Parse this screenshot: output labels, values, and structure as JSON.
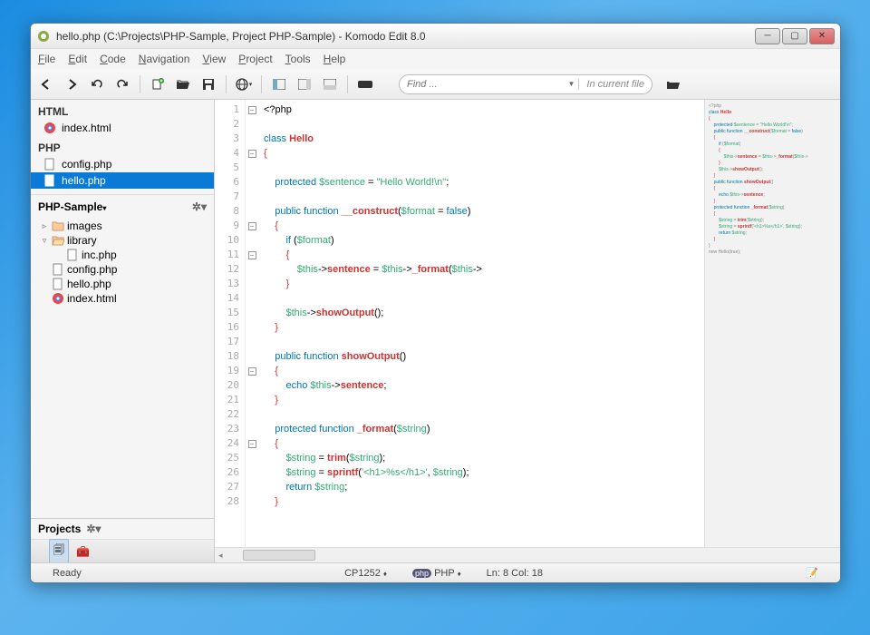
{
  "window": {
    "title": "hello.php (C:\\Projects\\PHP-Sample, Project PHP-Sample) - Komodo Edit 8.0"
  },
  "menu": {
    "items": [
      "File",
      "Edit",
      "Code",
      "Navigation",
      "View",
      "Project",
      "Tools",
      "Help"
    ]
  },
  "find": {
    "placeholder": "Find ...",
    "scope": "In current file"
  },
  "sidebar": {
    "groups": [
      {
        "label": "HTML",
        "items": [
          {
            "name": "index.html",
            "icon": "chrome"
          }
        ]
      },
      {
        "label": "PHP",
        "items": [
          {
            "name": "config.php",
            "icon": "file"
          },
          {
            "name": "hello.php",
            "icon": "file",
            "selected": true
          }
        ]
      }
    ],
    "project": {
      "name": "PHP-Sample",
      "tree": [
        {
          "label": "images",
          "icon": "folder",
          "indent": 0,
          "twisty": "▹"
        },
        {
          "label": "library",
          "icon": "folder-open",
          "indent": 0,
          "twisty": "▿"
        },
        {
          "label": "inc.php",
          "icon": "file",
          "indent": 1,
          "twisty": ""
        },
        {
          "label": "config.php",
          "icon": "file",
          "indent": 0,
          "twisty": ""
        },
        {
          "label": "hello.php",
          "icon": "file",
          "indent": 0,
          "twisty": ""
        },
        {
          "label": "index.html",
          "icon": "chrome",
          "indent": 0,
          "twisty": ""
        }
      ]
    },
    "bottom": {
      "label": "Projects"
    }
  },
  "editor": {
    "filename": "hello.php",
    "lines": [
      {
        "n": 1,
        "fold": "-",
        "html": "&lt;?php"
      },
      {
        "n": 2,
        "fold": "",
        "html": ""
      },
      {
        "n": 3,
        "fold": "",
        "html": "<span class=c-kw>class</span> <span class=c-cls>Hello</span>"
      },
      {
        "n": 4,
        "fold": "-",
        "html": "<span class=c-br>{</span>"
      },
      {
        "n": 5,
        "fold": "",
        "html": ""
      },
      {
        "n": 6,
        "fold": "",
        "html": "    <span class=c-kw>protected</span> <span class=c-var>$sentence</span> = <span class=c-str>\"Hello World!\\n\"</span>;"
      },
      {
        "n": 7,
        "fold": "",
        "html": ""
      },
      {
        "n": 8,
        "fold": "",
        "html": "    <span class=c-kw>public</span> <span class=c-kw>function</span> <span class=c-fn>__construct</span>(<span class=c-var>$format</span> = <span class=c-kw>false</span>)"
      },
      {
        "n": 9,
        "fold": "-",
        "html": "    <span class=c-br>{</span>"
      },
      {
        "n": 10,
        "fold": "",
        "html": "        <span class=c-kw>if</span> (<span class=c-var>$format</span>)"
      },
      {
        "n": 11,
        "fold": "-",
        "html": "        <span class=c-br>{</span>"
      },
      {
        "n": 12,
        "fold": "",
        "html": "            <span class=c-var>$this</span>-&gt;<span class=c-fn>sentence</span> = <span class=c-var>$this</span>-&gt;<span class=c-fn>_format</span>(<span class=c-var>$this</span>-&gt;"
      },
      {
        "n": 13,
        "fold": "",
        "html": "        <span class=c-br>}</span>"
      },
      {
        "n": 14,
        "fold": "",
        "html": ""
      },
      {
        "n": 15,
        "fold": "",
        "html": "        <span class=c-var>$this</span>-&gt;<span class=c-fn>showOutput</span>();"
      },
      {
        "n": 16,
        "fold": "",
        "html": "    <span class=c-br>}</span>"
      },
      {
        "n": 17,
        "fold": "",
        "html": ""
      },
      {
        "n": 18,
        "fold": "",
        "html": "    <span class=c-kw>public</span> <span class=c-kw>function</span> <span class=c-fn>showOutput</span>()"
      },
      {
        "n": 19,
        "fold": "-",
        "html": "    <span class=c-br>{</span>"
      },
      {
        "n": 20,
        "fold": "",
        "html": "        <span class=c-kw>echo</span> <span class=c-var>$this</span>-&gt;<span class=c-fn>sentence</span>;"
      },
      {
        "n": 21,
        "fold": "",
        "html": "    <span class=c-br>}</span>"
      },
      {
        "n": 22,
        "fold": "",
        "html": ""
      },
      {
        "n": 23,
        "fold": "",
        "html": "    <span class=c-kw>protected</span> <span class=c-kw>function</span> <span class=c-fn>_format</span>(<span class=c-var>$string</span>)"
      },
      {
        "n": 24,
        "fold": "-",
        "html": "    <span class=c-br>{</span>"
      },
      {
        "n": 25,
        "fold": "",
        "html": "        <span class=c-var>$string</span> = <span class=c-fn>trim</span>(<span class=c-var>$string</span>);"
      },
      {
        "n": 26,
        "fold": "",
        "html": "        <span class=c-var>$string</span> = <span class=c-fn>sprintf</span>(<span class=c-str>'&lt;h1&gt;%s&lt;/h1&gt;'</span>, <span class=c-var>$string</span>);"
      },
      {
        "n": 27,
        "fold": "",
        "html": "        <span class=c-kw>return</span> <span class=c-var>$string</span>;"
      },
      {
        "n": 28,
        "fold": "",
        "html": "    <span class=c-br>}</span>"
      }
    ]
  },
  "status": {
    "ready": "Ready",
    "encoding": "CP1252",
    "lang_badge": "php",
    "language": "PHP",
    "position": "Ln: 8 Col: 18"
  }
}
